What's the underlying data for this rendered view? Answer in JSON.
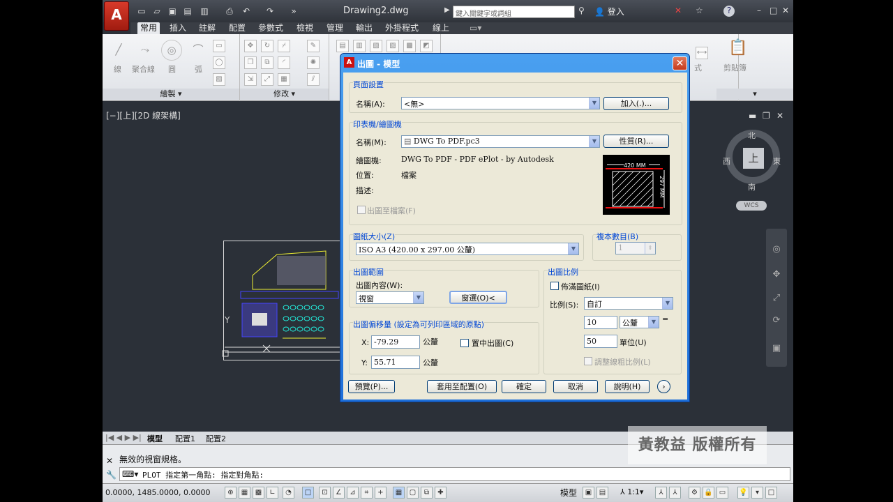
{
  "app": {
    "logo_letter": "A",
    "doc_title": "Drawing2.dwg",
    "search_placeholder": "鍵入關鍵字或詞組",
    "login": "登入",
    "help": "?"
  },
  "ribbon_tabs": [
    "常用",
    "插入",
    "註解",
    "配置",
    "參數式",
    "檢視",
    "管理",
    "輸出",
    "外掛程式",
    "線上"
  ],
  "ribbon": {
    "draw_group": "繪製",
    "modify_group": "修改",
    "line": "線",
    "polyline": "聚合線",
    "circle": "圓",
    "arc": "弧",
    "layer_text": "式",
    "clipboard": "剪貼簿"
  },
  "viewport": {
    "label": "[−][上][2D 線架構]",
    "compass": {
      "n": "北",
      "s": "南",
      "e": "東",
      "w": "西",
      "top": "上"
    },
    "wcs": "WCS"
  },
  "layout_tabs": [
    "模型",
    "配置1",
    "配置2"
  ],
  "command": {
    "history": "無效的視窗規格。",
    "input": "PLOT 指定第一角點: 指定對角點:"
  },
  "status": {
    "coords": "0.0000,  1485.0000, 0.0000",
    "model": "模型",
    "scale": "1:1"
  },
  "watermark": "黃教益  版權所有",
  "dialog": {
    "title": "出圖 - 模型",
    "page_setup": {
      "group": "頁面設置",
      "name_label": "名稱(A):",
      "name_value": "<無>",
      "add_button": "加入(.)..."
    },
    "printer": {
      "group": "印表機/繪圖機",
      "name_label": "名稱(M):",
      "name_value": "DWG To PDF.pc3",
      "props_button": "性質(R)...",
      "plotter_label": "繪圖機:",
      "plotter_value": "DWG To PDF - PDF ePlot - by Autodesk",
      "where_label": "位置:",
      "where_value": "檔案",
      "desc_label": "描述:",
      "plot_to_file": "出圖至檔案(F)",
      "preview_width": "420 MM",
      "preview_height": "297 MM"
    },
    "paper": {
      "group": "圖紙大小(Z)",
      "value": "ISO A3 (420.00 x 297.00 公釐)"
    },
    "copies": {
      "group": "複本數目(B)",
      "value": "1"
    },
    "area": {
      "group": "出圖範圍",
      "what_label": "出圖內容(W):",
      "what_value": "視窗",
      "window_button": "窗選(O)<"
    },
    "offset": {
      "group": "出圖偏移量 (設定為可列印區域的原點)",
      "x_label": "X:",
      "x_value": "-79.29",
      "y_label": "Y:",
      "y_value": "55.71",
      "unit": "公釐",
      "center": "置中出圖(C)"
    },
    "scale": {
      "group": "出圖比例",
      "fit": "佈滿圖紙(I)",
      "scale_label": "比例(S):",
      "scale_value": "自訂",
      "mm_value": "10",
      "mm_unit": "公釐",
      "eq": "=",
      "units_value": "50",
      "units_label": "單位(U)",
      "lineweights": "調整線粗比例(L)"
    },
    "buttons": {
      "preview": "預覽(P)...",
      "apply": "套用至配置(O)",
      "ok": "確定",
      "cancel": "取消",
      "help": "說明(H)"
    }
  }
}
